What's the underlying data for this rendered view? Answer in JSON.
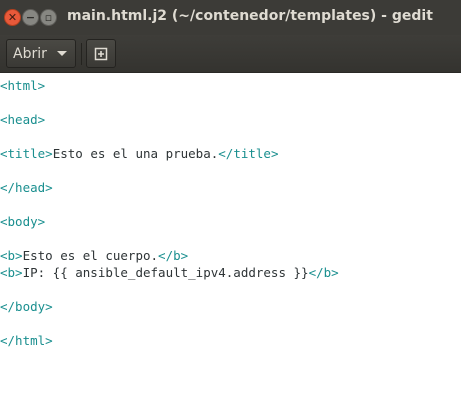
{
  "window": {
    "title": "main.html.j2 (~/contenedor/templates) - gedit",
    "close_glyph": "✕",
    "minimize_glyph": "−",
    "maximize_glyph": "▫"
  },
  "toolbar": {
    "open_label": "Abrir",
    "open_icon": "chevron-down-icon",
    "new_tab_icon": "new-tab-plus-icon"
  },
  "editor": {
    "lines": [
      {
        "open": "<html>",
        "text": "",
        "close": ""
      },
      {
        "open": "",
        "text": "",
        "close": ""
      },
      {
        "open": "<head>",
        "text": "",
        "close": ""
      },
      {
        "open": "",
        "text": "",
        "close": ""
      },
      {
        "open": "<title>",
        "text": "Esto es el una prueba.",
        "close": "</title>"
      },
      {
        "open": "",
        "text": "",
        "close": ""
      },
      {
        "open": "</head>",
        "text": "",
        "close": ""
      },
      {
        "open": "",
        "text": "",
        "close": ""
      },
      {
        "open": "<body>",
        "text": "",
        "close": ""
      },
      {
        "open": "",
        "text": "",
        "close": ""
      },
      {
        "open": "<b>",
        "text": "Esto es el cuerpo.",
        "close": "</b>"
      },
      {
        "open": "<b>",
        "text": "IP: {{ ansible_default_ipv4.address }}",
        "close": "</b>"
      },
      {
        "open": "",
        "text": "",
        "close": ""
      },
      {
        "open": "</body>",
        "text": "",
        "close": ""
      },
      {
        "open": "",
        "text": "",
        "close": ""
      },
      {
        "open": "</html>",
        "text": "",
        "close": ""
      }
    ]
  },
  "colors": {
    "titlebar_bg": "#3c3b37",
    "close_button": "#e8593a",
    "tag_color": "#1a8f8f",
    "text_color": "#2e3436",
    "editor_bg": "#ffffff"
  }
}
